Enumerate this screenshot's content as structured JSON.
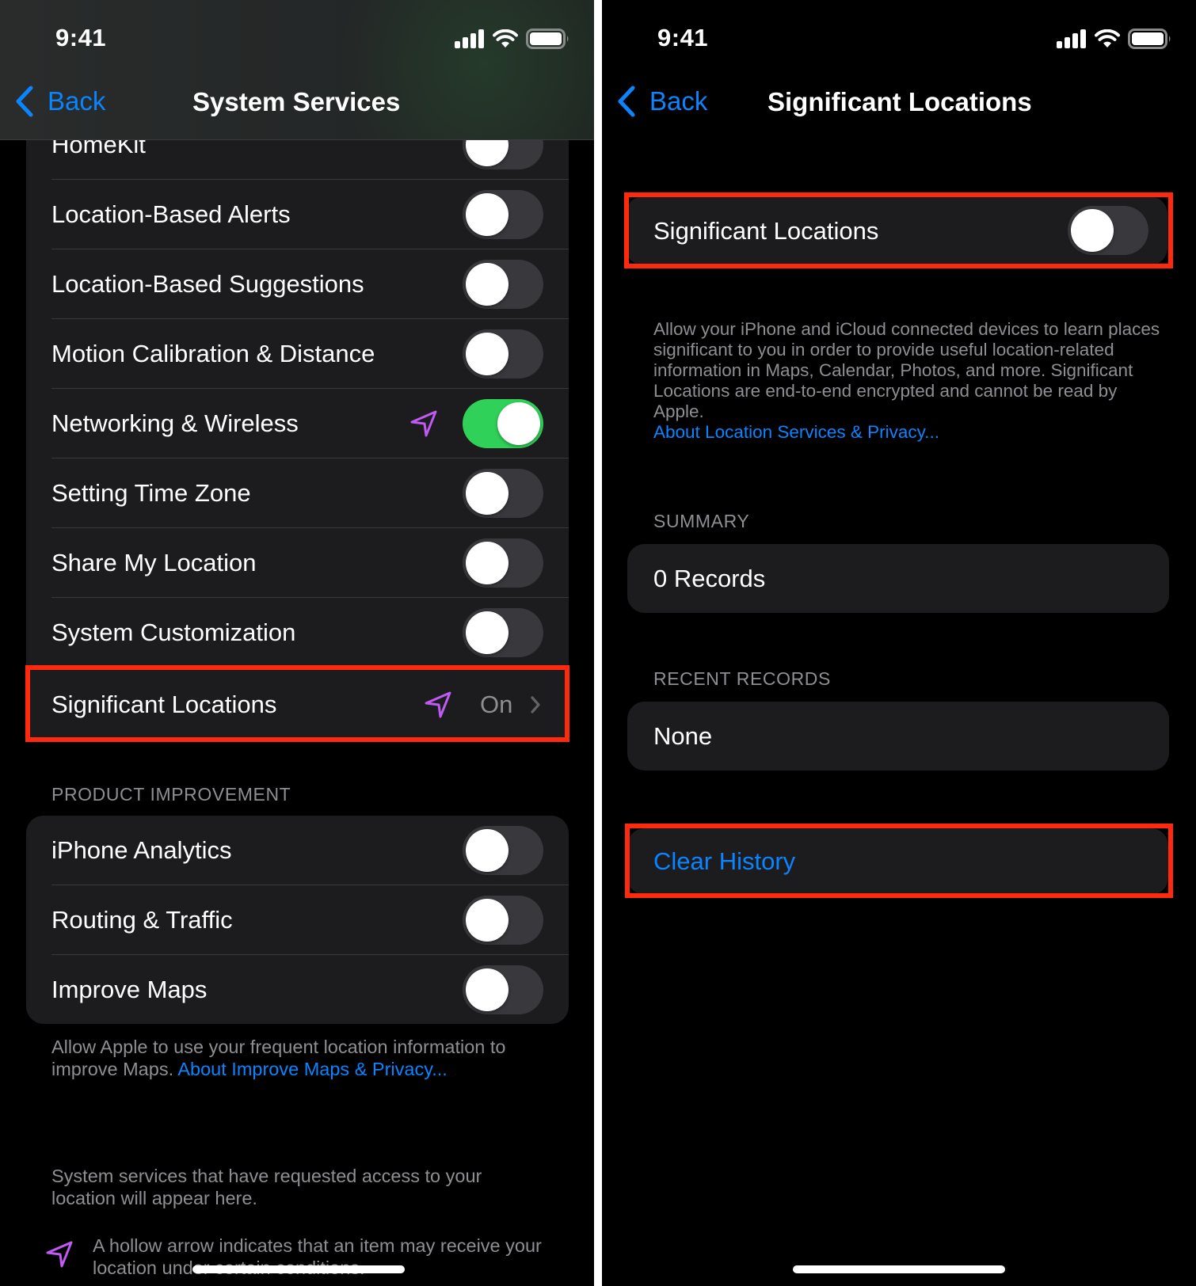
{
  "left": {
    "status_bar": {
      "time": "9:41"
    },
    "nav": {
      "back_label": "Back",
      "title": "System Services"
    },
    "rows": [
      {
        "label": "HomeKit",
        "toggle_on": false,
        "location_arrow": false
      },
      {
        "label": "Location-Based Alerts",
        "toggle_on": false,
        "location_arrow": false
      },
      {
        "label": "Location-Based Suggestions",
        "toggle_on": false,
        "location_arrow": false
      },
      {
        "label": "Motion Calibration & Distance",
        "toggle_on": false,
        "location_arrow": false
      },
      {
        "label": "Networking & Wireless",
        "toggle_on": true,
        "location_arrow": true
      },
      {
        "label": "Setting Time Zone",
        "toggle_on": false,
        "location_arrow": false
      },
      {
        "label": "Share My Location",
        "toggle_on": false,
        "location_arrow": false
      },
      {
        "label": "System Customization",
        "toggle_on": false,
        "location_arrow": false
      }
    ],
    "significant_locations": {
      "label": "Significant Locations",
      "value": "On",
      "location_arrow": true
    },
    "product_improvement": {
      "header": "PRODUCT IMPROVEMENT",
      "rows": [
        {
          "label": "iPhone Analytics",
          "toggle_on": false
        },
        {
          "label": "Routing & Traffic",
          "toggle_on": false
        },
        {
          "label": "Improve Maps",
          "toggle_on": false
        }
      ],
      "footer_text": "Allow Apple to use your frequent location information to improve Maps.",
      "footer_link": "About Improve Maps & Privacy..."
    },
    "system_services_note": "System services that have requested access to your location will appear here.",
    "hollow_arrow_note": "A hollow arrow indicates that an item may receive your location under certain conditions."
  },
  "right": {
    "status_bar": {
      "time": "9:41"
    },
    "nav": {
      "back_label": "Back",
      "title": "Significant Locations"
    },
    "toggle_row": {
      "label": "Significant Locations",
      "toggle_on": false
    },
    "description": "Allow your iPhone and iCloud connected devices to learn places significant to you in order to provide useful location-related information in Maps, Calendar, Photos, and more. Significant Locations are end-to-end encrypted and cannot be read by Apple.",
    "description_link": "About Location Services & Privacy...",
    "summary": {
      "header": "SUMMARY",
      "value": "0 Records"
    },
    "recent_records": {
      "header": "RECENT RECORDS",
      "value": "None"
    },
    "clear_history_label": "Clear History"
  },
  "colors": {
    "accent_blue": "#0a84ff",
    "toggle_on_green": "#30d158",
    "location_arrow_purple": "#bf5af2",
    "highlight_red": "#ff2a0d",
    "cell_background": "#1c1c1e"
  }
}
